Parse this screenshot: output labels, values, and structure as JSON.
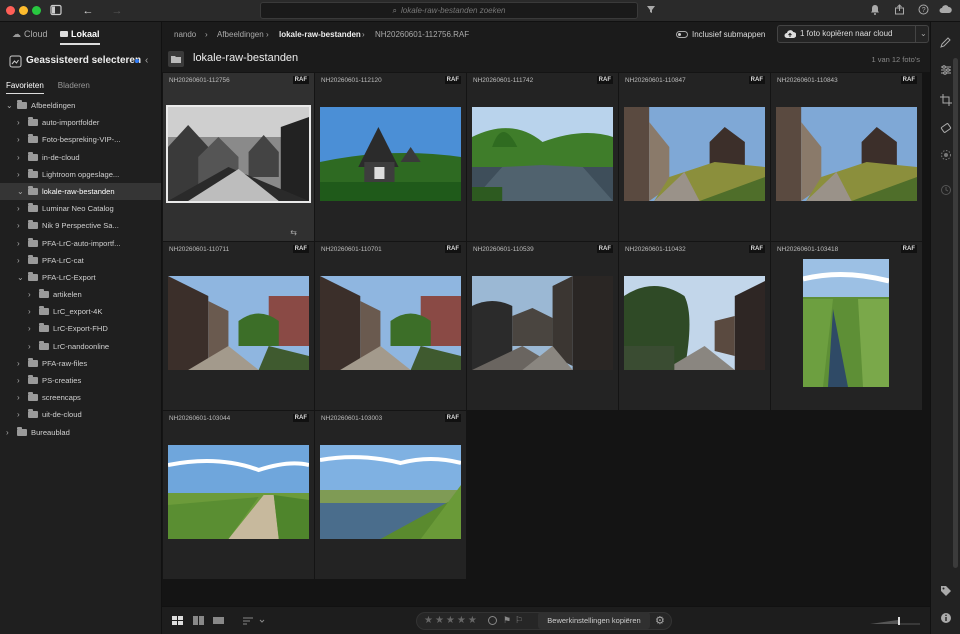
{
  "search": {
    "placeholder": "lokale-raw-bestanden zoeken"
  },
  "sidebar": {
    "source_tabs": [
      "Cloud",
      "Lokaal"
    ],
    "title": "Geassisteerd selecteren",
    "subtabs": [
      "Favorieten",
      "Bladeren"
    ],
    "tree": [
      {
        "label": "Afbeeldingen",
        "level": 0,
        "open": true
      },
      {
        "label": "auto-importfolder",
        "level": 1
      },
      {
        "label": "Foto-bespreking-VIP-...",
        "level": 1
      },
      {
        "label": "in-de-cloud",
        "level": 1
      },
      {
        "label": "Lightroom opgeslage...",
        "level": 1
      },
      {
        "label": "lokale-raw-bestanden",
        "level": 1,
        "selected": true,
        "open": true
      },
      {
        "label": "Luminar Neo Catalog",
        "level": 1
      },
      {
        "label": "Nik 9 Perspective Sa...",
        "level": 1
      },
      {
        "label": "PFA-LrC-auto-importf...",
        "level": 1
      },
      {
        "label": "PFA-LrC-cat",
        "level": 1
      },
      {
        "label": "PFA-LrC-Export",
        "level": 1,
        "open": true
      },
      {
        "label": "artikelen",
        "level": 2
      },
      {
        "label": "LrC_export-4K",
        "level": 2
      },
      {
        "label": "LrC-Export-FHD",
        "level": 2
      },
      {
        "label": "LrC-nandoonline",
        "level": 2
      },
      {
        "label": "PFA-raw-files",
        "level": 1
      },
      {
        "label": "PS-creaties",
        "level": 1
      },
      {
        "label": "screencaps",
        "level": 1
      },
      {
        "label": "uit-de-cloud",
        "level": 1
      },
      {
        "label": "Bureaublad",
        "level": 0
      }
    ]
  },
  "breadcrumb": {
    "items": [
      "nando",
      "Afbeeldingen",
      "lokale-raw-bestanden",
      "NH20260601-112756.RAF"
    ],
    "separator": "›"
  },
  "toolbar": {
    "include_subfolders": "Inclusief submappen",
    "copy_button": "1 foto kopiëren naar cloud",
    "copy_icon": "cloud-upload-icon"
  },
  "folder": {
    "title": "lokale-raw-bestanden",
    "count": "1 van 12 foto's"
  },
  "photos": [
    {
      "name": "NH20260601-112756",
      "badge": "RAF",
      "scene": "bw",
      "selected": true
    },
    {
      "name": "NH20260601-112120",
      "badge": "RAF",
      "scene": "house"
    },
    {
      "name": "NH20260601-111742",
      "badge": "RAF",
      "scene": "canal"
    },
    {
      "name": "NH20260601-110847",
      "badge": "RAF",
      "scene": "street"
    },
    {
      "name": "NH20260601-110843",
      "badge": "RAF",
      "scene": "street"
    },
    {
      "name": "NH20260601-110711",
      "badge": "RAF",
      "scene": "street2"
    },
    {
      "name": "NH20260601-110701",
      "badge": "RAF",
      "scene": "street2"
    },
    {
      "name": "NH20260601-110539",
      "badge": "RAF",
      "scene": "dark"
    },
    {
      "name": "NH20260601-110432",
      "badge": "RAF",
      "scene": "dark2"
    },
    {
      "name": "NH20260601-103418",
      "badge": "RAF",
      "scene": "reeds",
      "portrait": true
    },
    {
      "name": "NH20260601-103044",
      "badge": "RAF",
      "scene": "path"
    },
    {
      "name": "NH20260601-103003",
      "badge": "RAF",
      "scene": "lake"
    }
  ],
  "bottombar": {
    "copy_edits": "Bewerkinstellingen kopiëren",
    "stars": 5
  },
  "colors": {
    "accent": "#2f7bf6",
    "window": "#161616",
    "sidebar": "#1f1f1f"
  }
}
